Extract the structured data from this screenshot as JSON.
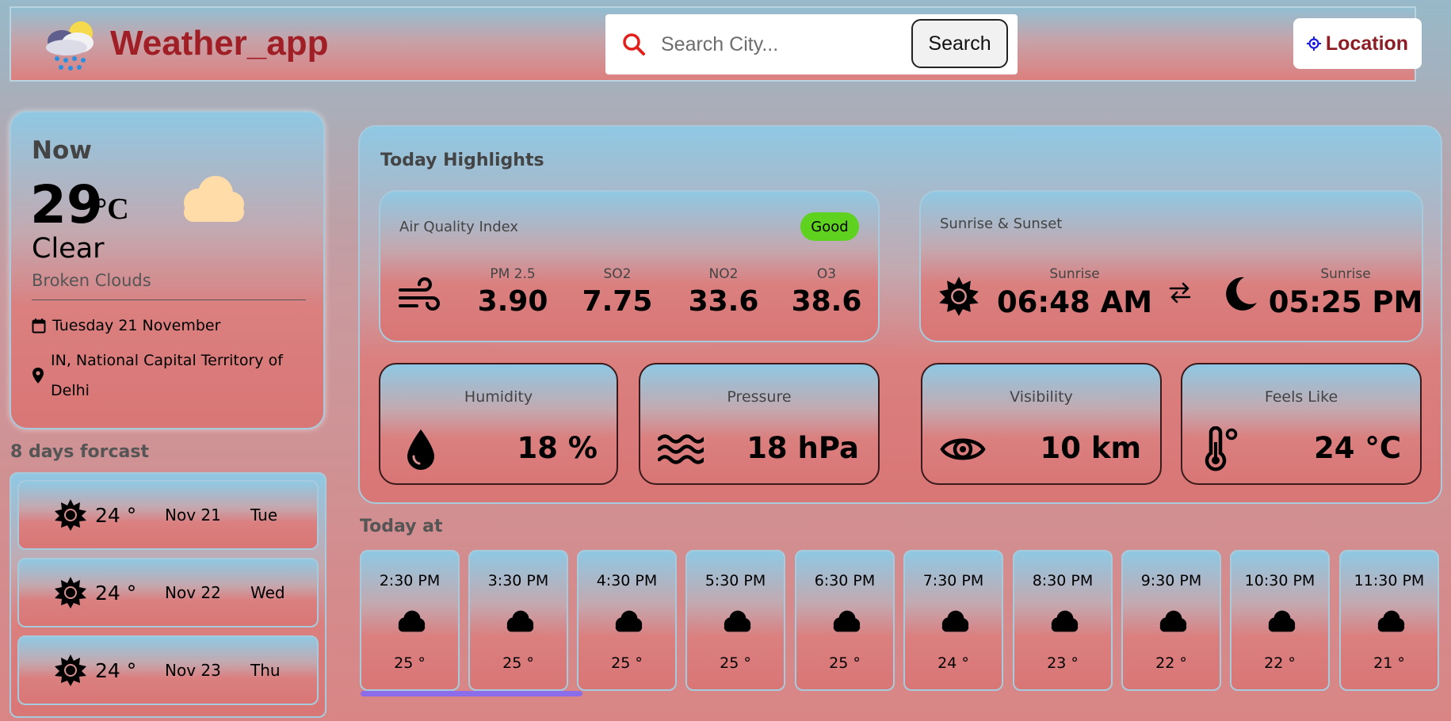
{
  "app": {
    "title": "Weather_app",
    "brand_color": "#a01f26",
    "accent_color": "#5fd21f"
  },
  "search": {
    "placeholder": "Search City...",
    "button_label": "Search",
    "icon": "search-icon"
  },
  "location_button": {
    "label": "Location",
    "icon": "crosshair-icon"
  },
  "current": {
    "heading": "Now",
    "temperature": "29",
    "unit": "°C",
    "condition": "Clear",
    "description": "Broken Clouds",
    "date": "Tuesday  21  November",
    "location": "IN, National Capital Territory of Delhi",
    "icon": "cloud-icon"
  },
  "forecast": {
    "title": "8 days forcast",
    "items": [
      {
        "temp": "24 °",
        "date": "Nov  21",
        "day": "Tue",
        "icon": "sun-icon"
      },
      {
        "temp": "24 °",
        "date": "Nov  22",
        "day": "Wed",
        "icon": "sun-icon"
      },
      {
        "temp": "24 °",
        "date": "Nov  23",
        "day": "Thu",
        "icon": "sun-icon"
      }
    ]
  },
  "highlights": {
    "title": "Today Highlights",
    "aqi": {
      "label": "Air Quality Index",
      "badge": "Good",
      "items": [
        {
          "name": "PM 2.5",
          "value": "3.90"
        },
        {
          "name": "SO2",
          "value": "7.75"
        },
        {
          "name": "NO2",
          "value": "33.6"
        },
        {
          "name": "O3",
          "value": "38.6"
        }
      ]
    },
    "sun": {
      "label": "Sunrise & Sunset",
      "sunrise_label": "Sunrise",
      "sunrise_value": "06:48 AM",
      "sunset_label": "Sunrise",
      "sunset_value": "05:25 PM"
    },
    "humidity": {
      "label": "Humidity",
      "value": "18 %"
    },
    "pressure": {
      "label": "Pressure",
      "value": "18 hPa"
    },
    "visibility": {
      "label": "Visibility",
      "value": "10 km"
    },
    "feels_like": {
      "label": "Feels Like",
      "value": "24 °C"
    }
  },
  "hourly": {
    "title": "Today at",
    "items": [
      {
        "time": "2:30 PM",
        "temp": "25 °"
      },
      {
        "time": "3:30 PM",
        "temp": "25 °"
      },
      {
        "time": "4:30 PM",
        "temp": "25 °"
      },
      {
        "time": "5:30 PM",
        "temp": "25 °"
      },
      {
        "time": "6:30 PM",
        "temp": "25 °"
      },
      {
        "time": "7:30 PM",
        "temp": "24 °"
      },
      {
        "time": "8:30 PM",
        "temp": "23 °"
      },
      {
        "time": "9:30 PM",
        "temp": "22 °"
      },
      {
        "time": "10:30 PM",
        "temp": "22 °"
      },
      {
        "time": "11:30 PM",
        "temp": "21 °"
      }
    ]
  }
}
